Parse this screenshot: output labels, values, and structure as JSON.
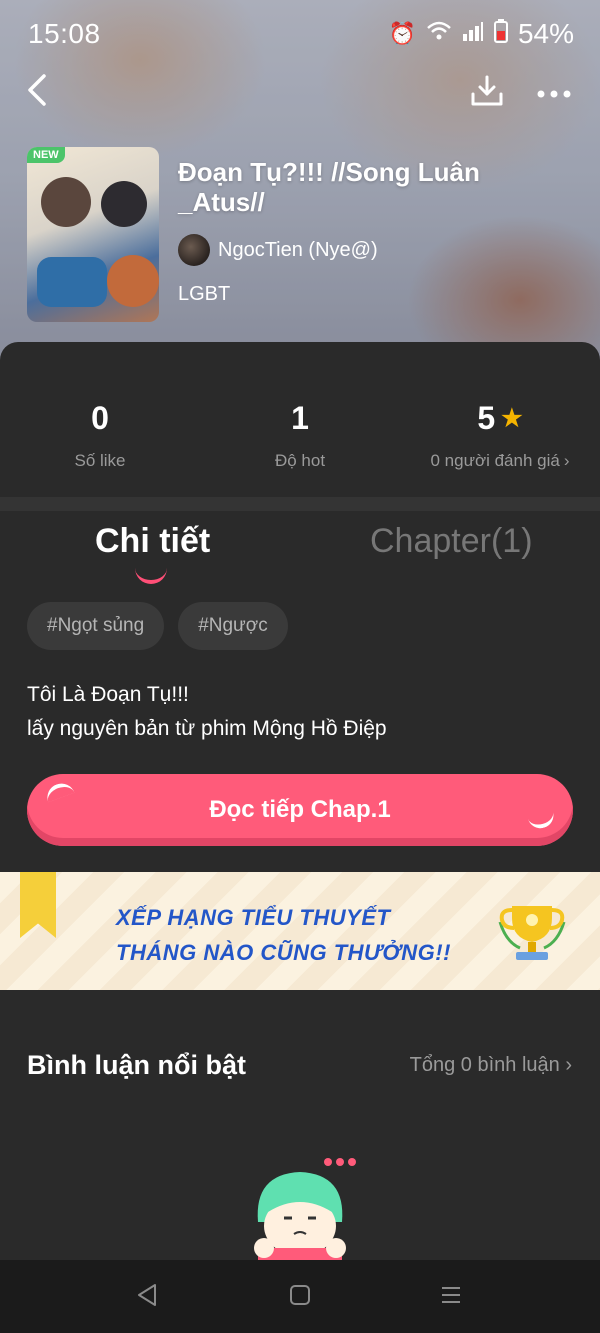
{
  "status_bar": {
    "time": "15:08",
    "battery": "54%"
  },
  "header": {
    "back_icon": "chevron-left-icon",
    "download_icon": "download-icon",
    "more_icon": "more-icon"
  },
  "story": {
    "badge": "NEW",
    "title": "Đoạn Tụ?!!! //Song Luân _Atus//",
    "author": "NgocTien (Nye@)",
    "genre": "LGBT"
  },
  "stats": {
    "likes_value": "0",
    "likes_label": "Số like",
    "hot_value": "1",
    "hot_label": "Độ hot",
    "rating_value": "5",
    "rating_label": "0 người đánh giá"
  },
  "tabs": {
    "details": "Chi tiết",
    "chapters": "Chapter(1)"
  },
  "tags": [
    "#Ngọt sủng",
    "#Ngược"
  ],
  "description": {
    "line1": "Tôi Là Đoạn Tụ!!!",
    "line2": "lấy nguyên bản từ phim Mộng Hồ Điệp"
  },
  "cta": {
    "label": "Đọc tiếp Chap.1"
  },
  "banner": {
    "line1": "XẾP HẠNG TIỂU THUYẾT",
    "line2": "THÁNG NÀO CŨNG THƯỞNG!!"
  },
  "comments": {
    "title": "Bình luận nổi bật",
    "total": "Tổng 0 bình luận"
  },
  "colors": {
    "accent": "#ff5b7a",
    "background": "#2a2a2a",
    "star": "#f5b400",
    "banner_text": "#2356c8"
  }
}
